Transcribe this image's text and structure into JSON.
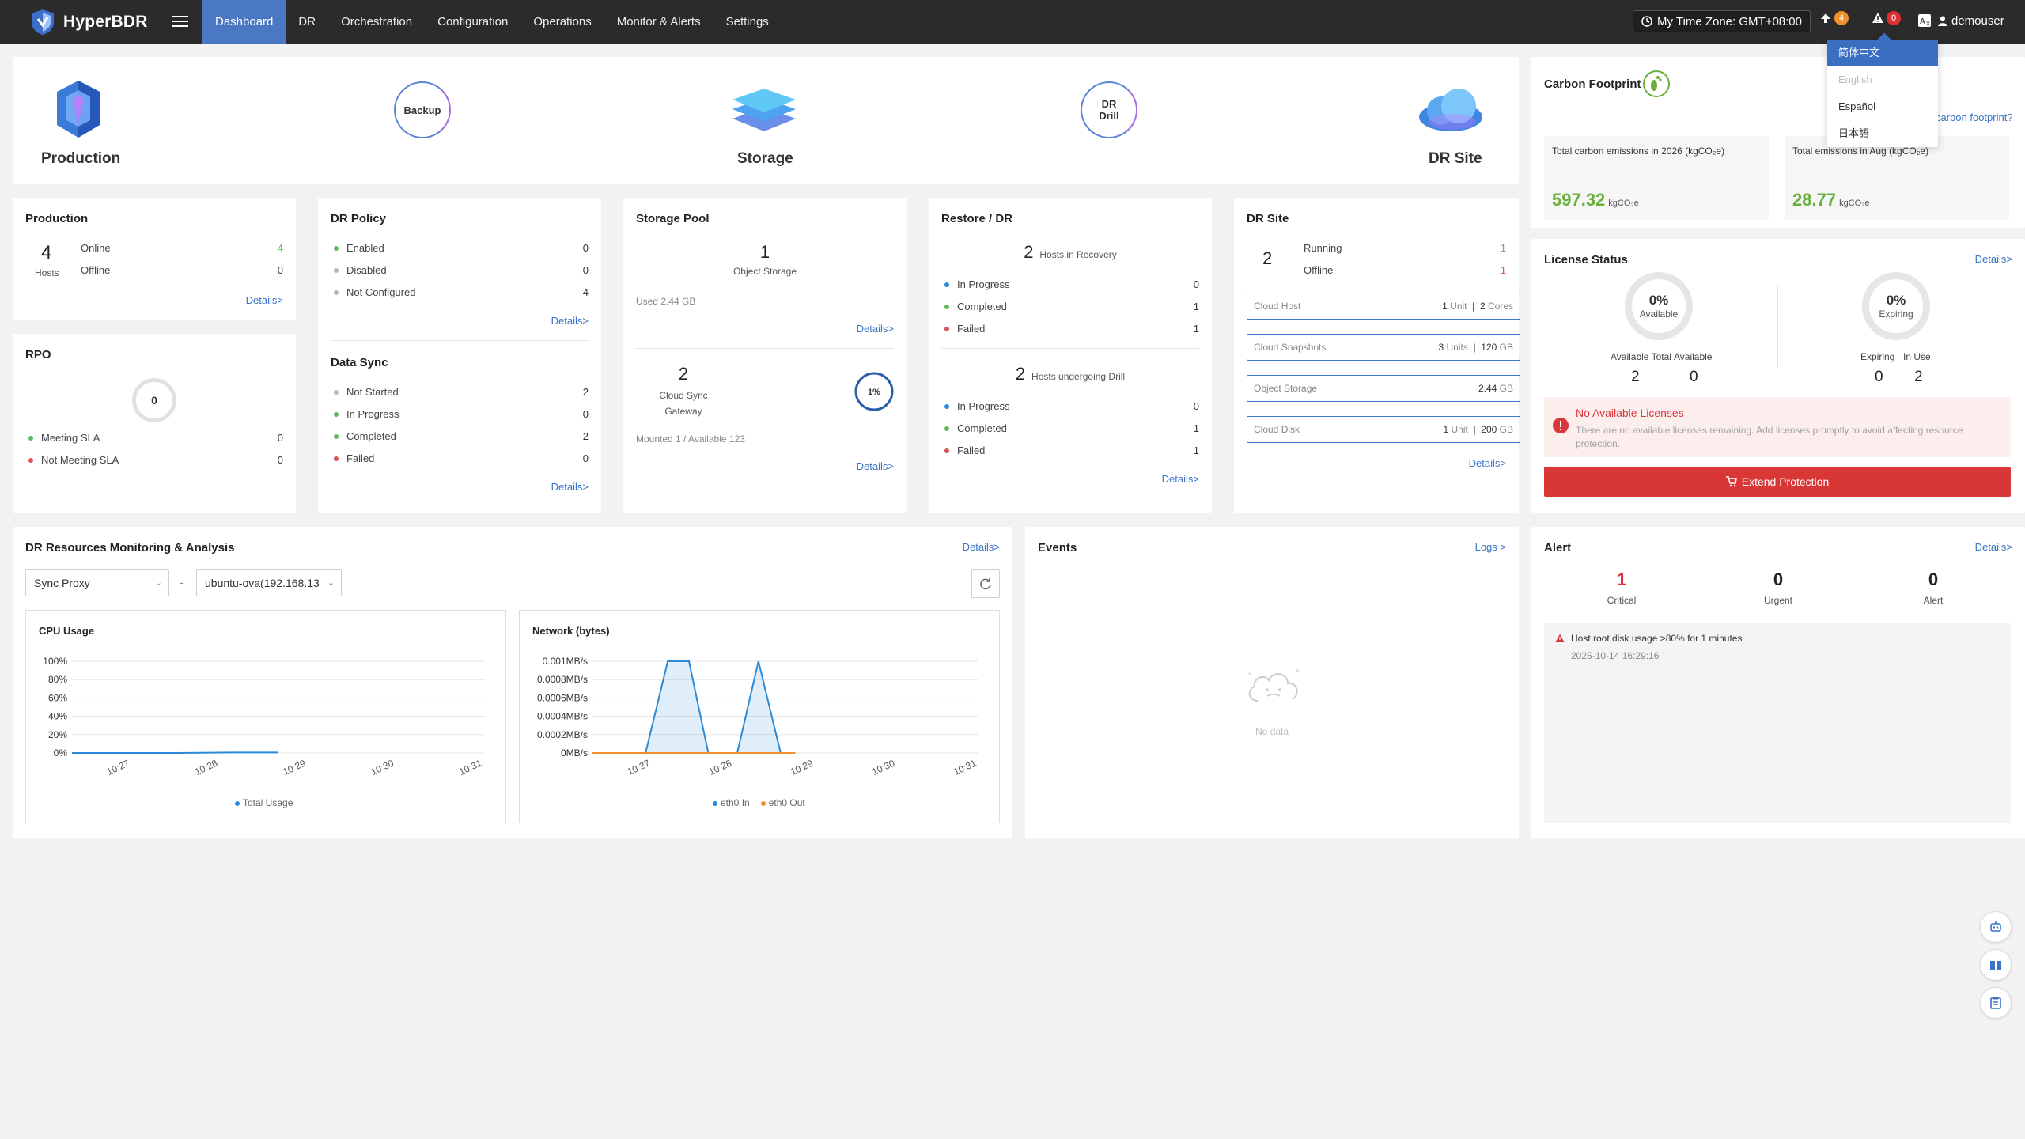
{
  "app": {
    "name": "HyperBDR"
  },
  "nav": {
    "items": [
      {
        "label": "Dashboard",
        "active": true
      },
      {
        "label": "DR"
      },
      {
        "label": "Orchestration"
      },
      {
        "label": "Configuration"
      },
      {
        "label": "Operations"
      },
      {
        "label": "Monitor & Alerts"
      },
      {
        "label": "Settings"
      }
    ],
    "timezone": "My Time Zone: GMT+08:00",
    "upgrade_badge": "4",
    "alert_badge": "0",
    "user": "demouser"
  },
  "language_menu": {
    "items": [
      "简体中文",
      "English",
      "Español",
      "日本語"
    ]
  },
  "flow": {
    "production": "Production",
    "backup": "Backup",
    "storage": "Storage",
    "dr_drill_1": "DR",
    "dr_drill_2": "Drill",
    "dr_site": "DR Site"
  },
  "carbon": {
    "title": "Carbon Footprint",
    "link": "carbon footprint?",
    "total_label": "Total carbon emissions in 2026 (kgCO₂e)",
    "total_value": "597.32",
    "month_label": "Total emissions in Aug (kgCO₂e)",
    "month_value": "28.77",
    "unit": "kgCO₂e"
  },
  "production": {
    "title": "Production",
    "hosts": "4",
    "hosts_label": "Hosts",
    "online_label": "Online",
    "online": "4",
    "offline_label": "Offline",
    "offline": "0",
    "details": "Details>"
  },
  "rpo": {
    "title": "RPO",
    "value": "0",
    "meeting_label": "Meeting SLA",
    "meeting": "0",
    "not_meeting_label": "Not Meeting SLA",
    "not_meeting": "0"
  },
  "dr_policy": {
    "title": "DR Policy",
    "enabled_label": "Enabled",
    "enabled": "0",
    "disabled_label": "Disabled",
    "disabled": "0",
    "not_configured_label": "Not Configured",
    "not_configured": "4",
    "details": "Details>"
  },
  "data_sync": {
    "title": "Data Sync",
    "not_started_label": "Not Started",
    "not_started": "2",
    "in_progress_label": "In Progress",
    "in_progress": "0",
    "completed_label": "Completed",
    "completed": "2",
    "failed_label": "Failed",
    "failed": "0",
    "details": "Details>"
  },
  "storage_pool": {
    "title": "Storage Pool",
    "count": "1",
    "count_label": "Object Storage",
    "used": "Used 2.44 GB",
    "details": "Details>",
    "gateway_count": "2",
    "gateway_label_1": "Cloud Sync",
    "gateway_label_2": "Gateway",
    "gateway_pct": "1%",
    "gateway_pct_value": 1,
    "mounted": "Mounted 1 / Available 123",
    "details2": "Details>"
  },
  "restore_dr": {
    "title": "Restore / DR",
    "recovery_count": "2",
    "recovery_label": "Hosts in Recovery",
    "r_in_progress_label": "In Progress",
    "r_in_progress": "0",
    "r_completed_label": "Completed",
    "r_completed": "1",
    "r_failed_label": "Failed",
    "r_failed": "1",
    "drill_count": "2",
    "drill_label": "Hosts undergoing Drill",
    "d_in_progress_label": "In Progress",
    "d_in_progress": "0",
    "d_completed_label": "Completed",
    "d_completed": "1",
    "d_failed_label": "Failed",
    "d_failed": "1",
    "details": "Details>"
  },
  "dr_site": {
    "title": "DR Site",
    "count": "2",
    "running_label": "Running",
    "running": "1",
    "offline_label": "Offline",
    "offline": "1",
    "cloud_host_label": "Cloud Host",
    "cloud_host_units": "1",
    "unit_word": "Unit",
    "cloud_host_cores": "2",
    "cores_word": "Cores",
    "snapshots_label": "Cloud Snapshots",
    "snapshots_units": "3",
    "units_word": "Units",
    "snapshots_gb": "120",
    "gb_word": "GB",
    "object_storage_label": "Object Storage",
    "object_storage_gb": "2.44",
    "cloud_disk_label": "Cloud Disk",
    "cloud_disk_units": "1",
    "cloud_disk_gb": "200",
    "details": "Details>"
  },
  "license": {
    "title": "License Status",
    "details": "Details>",
    "available_pct": "0%",
    "available_word": "Available",
    "expiring_pct": "0%",
    "expiring_word": "Expiring",
    "available_total_label": "Available Total",
    "available_total": "2",
    "available_label": "Available",
    "available": "0",
    "expiring_label": "Expiring",
    "expiring": "0",
    "in_use_label": "In Use",
    "in_use": "2",
    "warn_title": "No Available Licenses",
    "warn_text": "There are no available licenses remaining. Add licenses promptly to avoid affecting resource protection.",
    "extend": "Extend Protection"
  },
  "monitoring": {
    "title": "DR Resources Monitoring & Analysis",
    "details": "Details>",
    "proxy_select": "Sync Proxy",
    "dash": "-",
    "host_select": "ubuntu-ova(192.168.13"
  },
  "chart_data": [
    {
      "type": "line",
      "title": "CPU Usage",
      "x": [
        "10:27",
        "10:28",
        "10:29",
        "10:30",
        "10:31"
      ],
      "ylim": [
        0,
        100
      ],
      "yticks": [
        "0%",
        "20%",
        "40%",
        "60%",
        "80%",
        "100%"
      ],
      "series": [
        {
          "name": "Total Usage",
          "color": "#2a8ad8",
          "points": [
            [
              0,
              0
            ],
            [
              0.55,
              0
            ],
            [
              1.0,
              0
            ],
            [
              1.55,
              0.5
            ],
            [
              2.0,
              0.5
            ]
          ]
        }
      ],
      "grid": true,
      "legend": "bottom"
    },
    {
      "type": "area",
      "title": "Network (bytes)",
      "x": [
        "10:27",
        "10:28",
        "10:29",
        "10:30",
        "10:31"
      ],
      "ylim": [
        0,
        0.001
      ],
      "yticks": [
        "0MB/s",
        "0.0002MB/s",
        "0.0004MB/s",
        "0.0006MB/s",
        "0.0008MB/s",
        "0.001MB/s"
      ],
      "series": [
        {
          "name": "eth0 In",
          "color": "#2a8ad8",
          "points": [
            [
              0,
              0
            ],
            [
              0.55,
              0
            ],
            [
              0.78,
              0.001
            ],
            [
              1.0,
              0.001
            ],
            [
              1.2,
              0
            ],
            [
              1.5,
              0
            ],
            [
              1.72,
              0.001
            ],
            [
              1.95,
              0
            ],
            [
              2.1,
              0
            ]
          ]
        },
        {
          "name": "eth0 Out",
          "color": "#f0902a",
          "points": [
            [
              0,
              0
            ],
            [
              2.1,
              0
            ]
          ]
        }
      ],
      "grid": true,
      "legend": "bottom"
    }
  ],
  "events": {
    "title": "Events",
    "logs": "Logs >",
    "empty": "No data"
  },
  "alert": {
    "title": "Alert",
    "details": "Details>",
    "critical": "1",
    "critical_label": "Critical",
    "urgent": "0",
    "urgent_label": "Urgent",
    "alert": "0",
    "alert_label": "Alert",
    "items": [
      {
        "text": "Host root disk usage >80% for 1 minutes",
        "time": "2025-10-14 16:29:16"
      }
    ]
  }
}
